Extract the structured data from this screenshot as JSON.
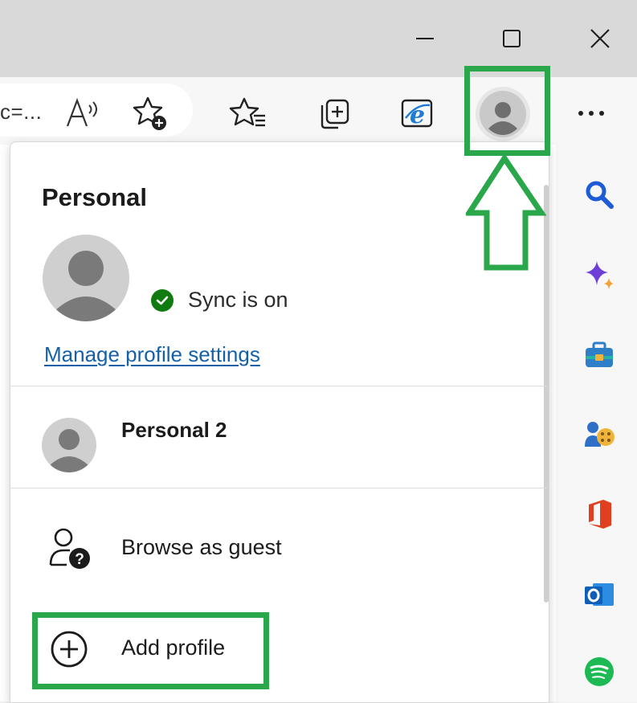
{
  "address": {
    "text": "c=..."
  },
  "profile_menu": {
    "heading": "Personal",
    "sync_status": "Sync is on",
    "manage_link": "Manage profile settings",
    "other_profiles": [
      {
        "name": "Personal 2"
      }
    ],
    "guest_label": "Browse as guest",
    "add_profile_label": "Add profile"
  },
  "icons": {
    "window": [
      "minimize-icon",
      "maximize-icon",
      "close-icon"
    ],
    "toolbar": [
      "read-aloud-icon",
      "add-favorite-icon",
      "favorites-icon",
      "collections-icon",
      "ie-mode-icon",
      "profile-icon",
      "more-icon"
    ],
    "sidebar": [
      "search-icon",
      "copilot-icon",
      "tools-icon",
      "games-icon",
      "office-icon",
      "outlook-icon",
      "spotify-icon"
    ]
  },
  "colors": {
    "highlight": "#29a74a",
    "link": "#1560a8",
    "sync": "#107c10",
    "titlebar": "#d9d9d9"
  }
}
